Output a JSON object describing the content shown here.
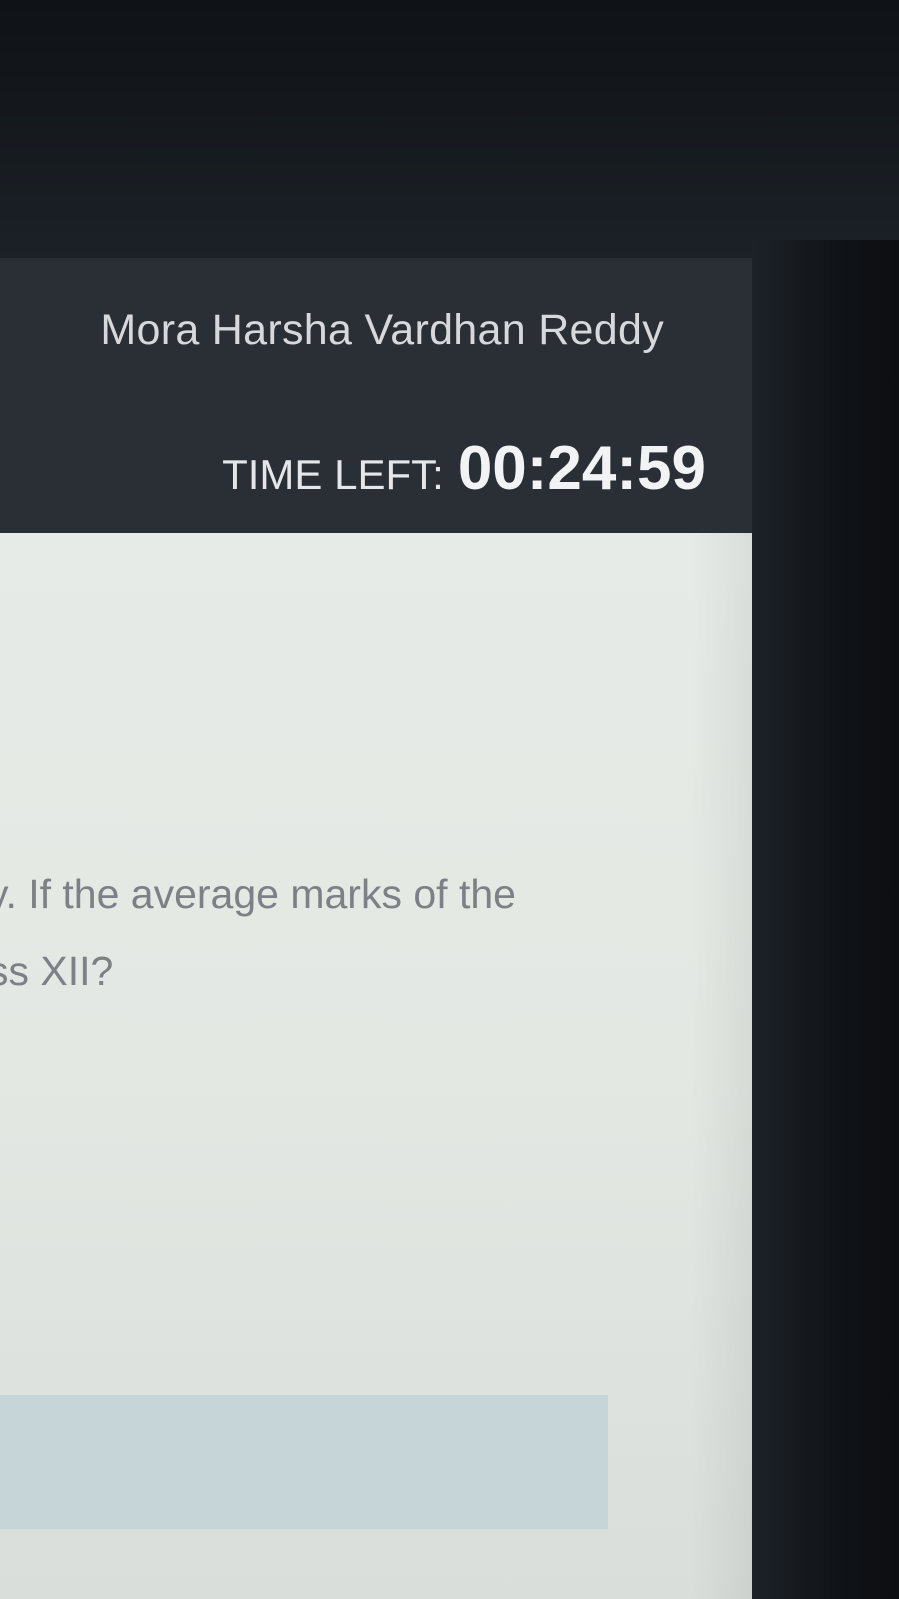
{
  "header": {
    "candidate_name": "Mora Harsha Vardhan Reddy",
    "timer_label": "TIME LEFT:",
    "timer_value": "00:24:59"
  },
  "question": {
    "line_1": "y. If the average marks of the",
    "line_2": "ss XII?"
  },
  "colors": {
    "header_bg": "#2a2f36",
    "content_bg": "#e6eae6",
    "answer_box_bg": "#c6d6d8",
    "question_text": "#7d8185"
  }
}
